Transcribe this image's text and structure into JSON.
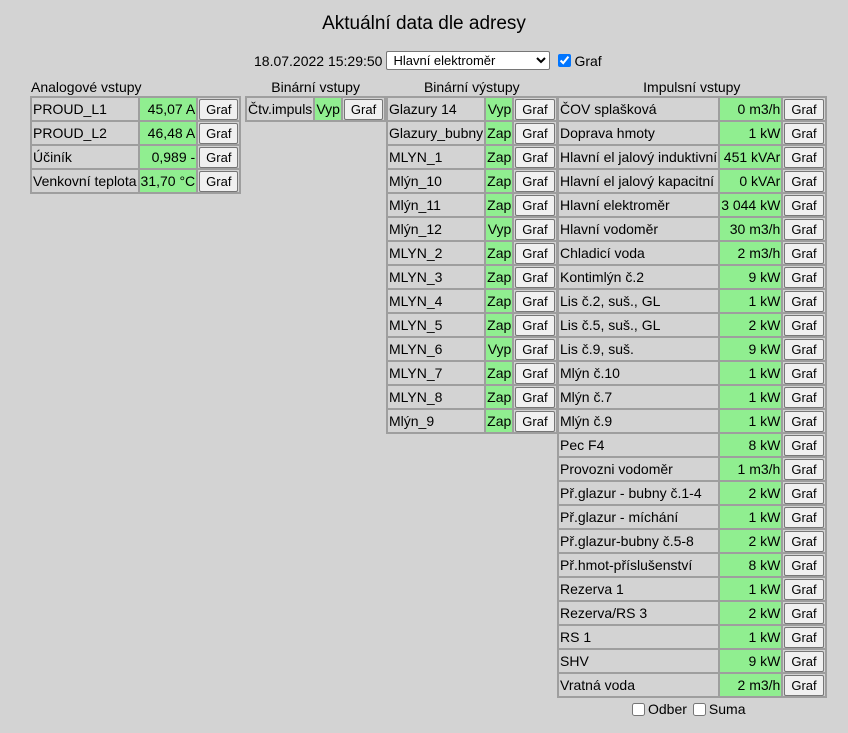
{
  "header": {
    "title": "Aktuální data dle adresy",
    "timestamp": "18.07.2022 15:29:50",
    "meter_select": {
      "selected": "Hlavní elektroměr"
    },
    "graf_checkbox": {
      "label": "Graf",
      "checked": true
    }
  },
  "button_label": "Graf",
  "analog": {
    "title": "Analogové vstupy",
    "rows": [
      {
        "name": "PROUD_L1",
        "value": "45,07 A"
      },
      {
        "name": "PROUD_L2",
        "value": "46,48 A"
      },
      {
        "name": "Účiník",
        "value": "0,989 -"
      },
      {
        "name": "Venkovní teplota",
        "value": "31,70 °C"
      }
    ]
  },
  "binary_in": {
    "title": "Binární vstupy",
    "rows": [
      {
        "name": "Čtv.impuls",
        "value": "Vyp"
      }
    ]
  },
  "binary_out": {
    "title": "Binární výstupy",
    "rows": [
      {
        "name": "Glazury 14",
        "value": "Vyp"
      },
      {
        "name": "Glazury_bubny",
        "value": "Zap"
      },
      {
        "name": "MLYN_1",
        "value": "Zap"
      },
      {
        "name": "Mlýn_10",
        "value": "Zap"
      },
      {
        "name": "Mlýn_11",
        "value": "Zap"
      },
      {
        "name": "Mlýn_12",
        "value": "Vyp"
      },
      {
        "name": "MLYN_2",
        "value": "Zap"
      },
      {
        "name": "MLYN_3",
        "value": "Zap"
      },
      {
        "name": "MLYN_4",
        "value": "Zap"
      },
      {
        "name": "MLYN_5",
        "value": "Zap"
      },
      {
        "name": "MLYN_6",
        "value": "Vyp"
      },
      {
        "name": "MLYN_7",
        "value": "Zap"
      },
      {
        "name": "MLYN_8",
        "value": "Zap"
      },
      {
        "name": "Mlýn_9",
        "value": "Zap"
      }
    ]
  },
  "impulse": {
    "title": "Impulsní vstupy",
    "rows": [
      {
        "name": "ČOV splašková",
        "value": "0 m3/h"
      },
      {
        "name": "Doprava hmoty",
        "value": "1 kW"
      },
      {
        "name": "Hlavní el jalový induktivní",
        "value": "451 kVAr"
      },
      {
        "name": "Hlavní el jalový kapacitní",
        "value": "0 kVAr"
      },
      {
        "name": "Hlavní elektroměr",
        "value": "3 044 kW"
      },
      {
        "name": "Hlavní vodoměr",
        "value": "30 m3/h"
      },
      {
        "name": "Chladicí voda",
        "value": "2 m3/h"
      },
      {
        "name": "Kontimlýn č.2",
        "value": "9 kW"
      },
      {
        "name": "Lis č.2, suš., GL",
        "value": "1 kW"
      },
      {
        "name": "Lis č.5, suš., GL",
        "value": "2 kW"
      },
      {
        "name": "Lis č.9, suš.",
        "value": "9 kW"
      },
      {
        "name": "Mlýn č.10",
        "value": "1 kW"
      },
      {
        "name": "Mlýn č.7",
        "value": "1 kW"
      },
      {
        "name": "Mlýn č.9",
        "value": "1 kW"
      },
      {
        "name": "Pec F4",
        "value": "8 kW"
      },
      {
        "name": "Provozni vodoměr",
        "value": "1 m3/h"
      },
      {
        "name": "Př.glazur - bubny č.1-4",
        "value": "2 kW"
      },
      {
        "name": "Př.glazur - míchání",
        "value": "1 kW"
      },
      {
        "name": "Př.glazur-bubny č.5-8",
        "value": "2 kW"
      },
      {
        "name": "Př.hmot-příslušenství",
        "value": "8 kW"
      },
      {
        "name": "Rezerva 1",
        "value": "1 kW"
      },
      {
        "name": "Rezerva/RS 3",
        "value": "2 kW"
      },
      {
        "name": "RS 1",
        "value": "1 kW"
      },
      {
        "name": "SHV",
        "value": "9 kW"
      },
      {
        "name": "Vratná voda",
        "value": "2 m3/h"
      }
    ]
  },
  "footer": {
    "odber": {
      "label": "Odber",
      "checked": false
    },
    "suma": {
      "label": "Suma",
      "checked": false
    }
  },
  "colors": {
    "background": "#d3d3d3",
    "value_cell": "#90ee90",
    "border": "#9e9e9e"
  }
}
